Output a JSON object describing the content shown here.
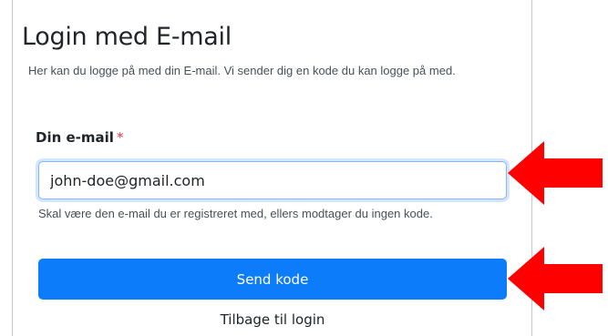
{
  "form": {
    "title": "Login med E-mail",
    "description": "Her kan du logge på med din E-mail. Vi sender dig en kode du kan logge på med.",
    "email_label": "Din e-mail",
    "required_marker": "*",
    "email_value": "john-doe@gmail.com",
    "email_help": "Skal være den e-mail du er registreret med, ellers modtager du ingen kode.",
    "send_button": "Send kode",
    "back_link": "Tilbage til login"
  },
  "annotations": {
    "arrow_icon": "arrow-left-icon",
    "arrow_color": "#ff0000"
  },
  "colors": {
    "primary": "#0d7cfb",
    "focus_border": "#86b7fe",
    "required": "#dc3545"
  }
}
